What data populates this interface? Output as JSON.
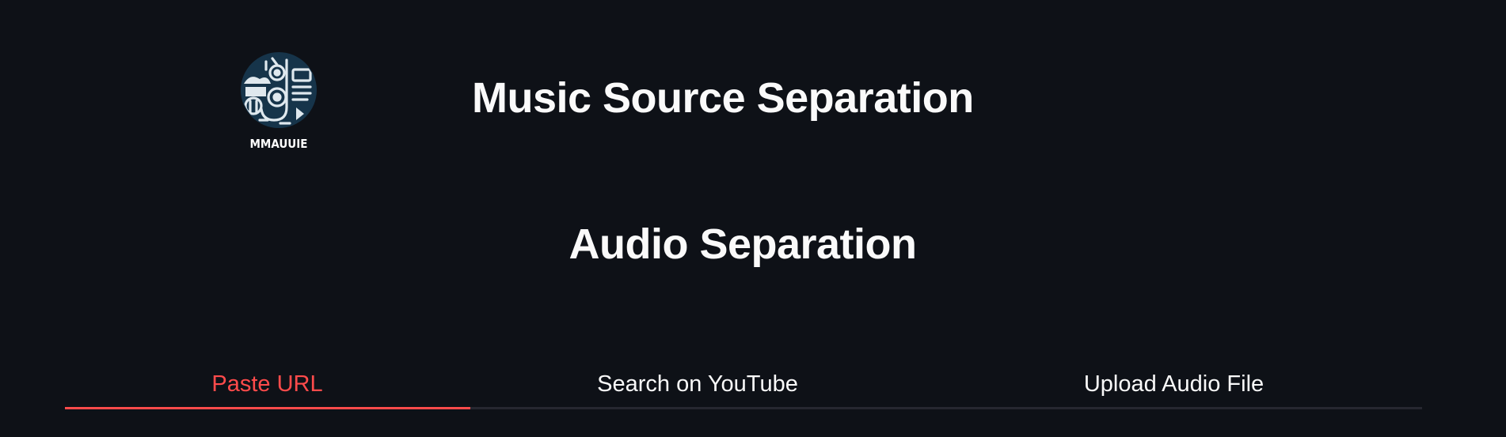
{
  "logo": {
    "text": "MMAUUIE"
  },
  "header": {
    "title": "Music Source Separation"
  },
  "main": {
    "section_title": "Audio Separation"
  },
  "tabs": [
    {
      "label": "Paste URL",
      "active": true
    },
    {
      "label": "Search on YouTube",
      "active": false
    },
    {
      "label": "Upload Audio File",
      "active": false
    }
  ],
  "colors": {
    "background": "#0e1117",
    "text": "#fafafa",
    "accent": "#ff4b4b",
    "tab_border": "#262730",
    "logo_dark": "#16344a"
  }
}
